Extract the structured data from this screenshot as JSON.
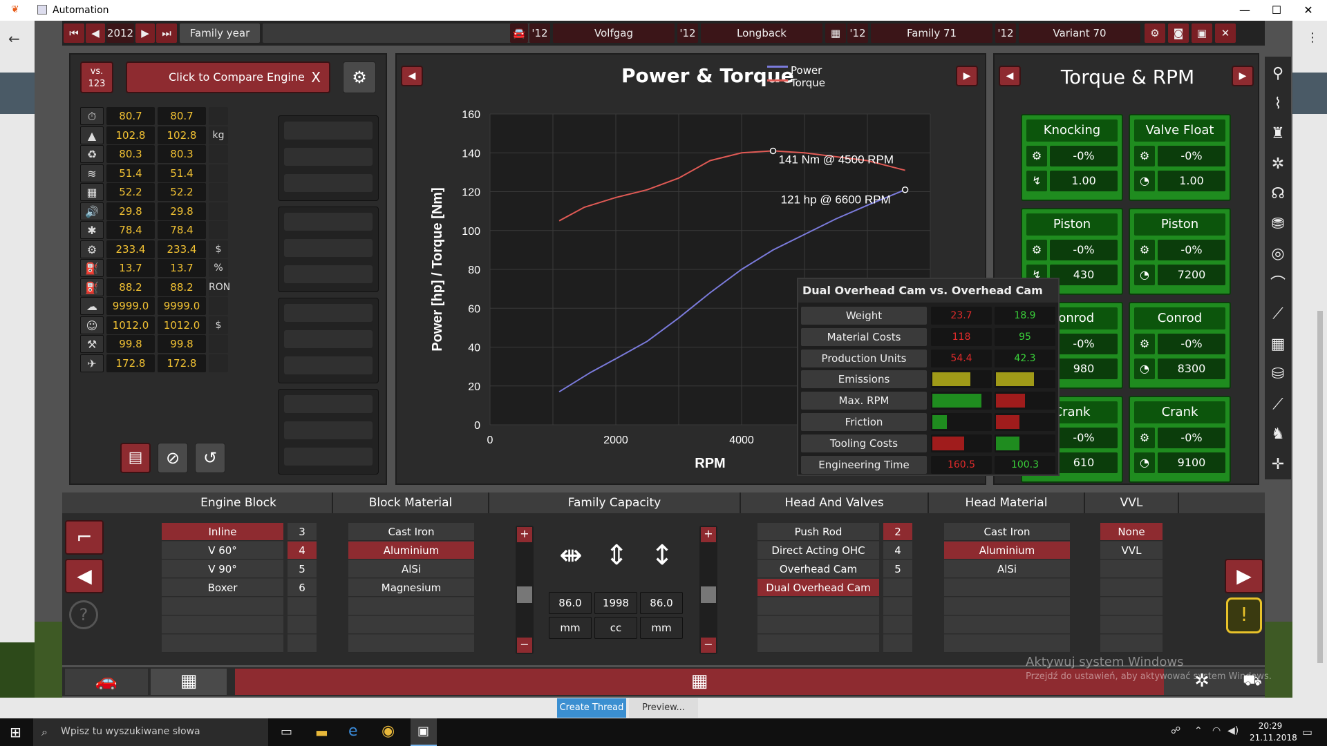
{
  "window": {
    "title": "Automation",
    "min": "—",
    "max": "☐",
    "close": "✕"
  },
  "topbar": {
    "year": "2012",
    "family_year_label": "Family year",
    "model_year_1": "'12",
    "brand": "Volfgag",
    "model_year_2": "'12",
    "model": "Longback",
    "model_year_3": "'12",
    "family": "Family 71",
    "model_year_4": "'12",
    "variant": "Variant 70"
  },
  "compare": {
    "vs_line1": "vs.",
    "vs_line2": "123",
    "label": "Click to Compare Engine",
    "close": "X"
  },
  "stats": [
    {
      "a": "80.7",
      "b": "80.7",
      "unit": "",
      "icon": "⏱"
    },
    {
      "a": "102.8",
      "b": "102.8",
      "unit": "kg",
      "icon": "▲"
    },
    {
      "a": "80.3",
      "b": "80.3",
      "unit": "",
      "icon": "♻"
    },
    {
      "a": "51.4",
      "b": "51.4",
      "unit": "",
      "icon": "≋"
    },
    {
      "a": "52.2",
      "b": "52.2",
      "unit": "",
      "icon": "▦"
    },
    {
      "a": "29.8",
      "b": "29.8",
      "unit": "",
      "icon": "🔊"
    },
    {
      "a": "78.4",
      "b": "78.4",
      "unit": "",
      "icon": "✱"
    },
    {
      "a": "233.4",
      "b": "233.4",
      "unit": "$",
      "icon": "⚙"
    },
    {
      "a": "13.7",
      "b": "13.7",
      "unit": "%",
      "icon": "⛽"
    },
    {
      "a": "88.2",
      "b": "88.2",
      "unit": "RON",
      "icon": "⛽"
    },
    {
      "a": "9999.0",
      "b": "9999.0",
      "unit": "",
      "icon": "☁"
    },
    {
      "a": "1012.0",
      "b": "1012.0",
      "unit": "$",
      "icon": "☺"
    },
    {
      "a": "99.8",
      "b": "99.8",
      "unit": "",
      "icon": "⚒"
    },
    {
      "a": "172.8",
      "b": "172.8",
      "unit": "",
      "icon": "✈"
    }
  ],
  "chart_header": {
    "title": "Power & Torque"
  },
  "chart_data": {
    "type": "line",
    "title": "Power & Torque",
    "xlabel": "RPM",
    "ylabel": "Power [hp] / Torque [Nm]",
    "xlim": [
      0,
      7000
    ],
    "ylim": [
      0,
      160
    ],
    "xticks": [
      0,
      2000,
      4000
    ],
    "yticks": [
      0,
      20,
      40,
      60,
      80,
      100,
      120,
      140,
      160
    ],
    "grid": true,
    "legend": "top",
    "series": [
      {
        "name": "Power",
        "color": "#7b7bdc",
        "x": [
          1100,
          1600,
          2000,
          2500,
          3000,
          3500,
          4000,
          4500,
          5000,
          5500,
          6000,
          6600
        ],
        "y": [
          17,
          27,
          34,
          43,
          55,
          68,
          80,
          90,
          98,
          106,
          113,
          121
        ]
      },
      {
        "name": "Torque",
        "color": "#e05a55",
        "x": [
          1100,
          1500,
          2000,
          2500,
          3000,
          3500,
          4000,
          4500,
          5000,
          5500,
          6000,
          6600
        ],
        "y": [
          105,
          112,
          117,
          121,
          127,
          136,
          140,
          141,
          140,
          138,
          136,
          131
        ]
      }
    ],
    "annotations": [
      {
        "text": "141 Nm @ 4500 RPM",
        "x": 4500,
        "y": 141
      },
      {
        "text": "121 hp @ 6600 RPM",
        "x": 6600,
        "y": 121
      }
    ]
  },
  "torque_panel": {
    "title": "Torque & RPM",
    "items": [
      {
        "name": "Knocking",
        "pct": "-0%",
        "val": "1.00"
      },
      {
        "name": "Valve Float",
        "pct": "-0%",
        "val": "1.00"
      },
      {
        "name": "Piston",
        "pct": "-0%",
        "val": "430"
      },
      {
        "name": "Piston",
        "pct": "-0%",
        "val": "7200"
      },
      {
        "name": "Conrod",
        "pct": "-0%",
        "val": "980"
      },
      {
        "name": "Conrod",
        "pct": "-0%",
        "val": "8300"
      },
      {
        "name": "Crank",
        "pct": "-0%",
        "val": "610"
      },
      {
        "name": "Crank",
        "pct": "-0%",
        "val": "9100"
      }
    ]
  },
  "tooltip": {
    "title": "Dual Overhead Cam  vs.  Overhead Cam",
    "rows": [
      {
        "label": "Weight",
        "a": "23.7",
        "b": "18.9"
      },
      {
        "label": "Material Costs",
        "a": "118",
        "b": "95"
      },
      {
        "label": "Production Units",
        "a": "54.4",
        "b": "42.3"
      },
      {
        "label": "Emissions",
        "a": "",
        "b": ""
      },
      {
        "label": "Max. RPM",
        "a": "",
        "b": ""
      },
      {
        "label": "Friction",
        "a": "",
        "b": ""
      },
      {
        "label": "Tooling Costs",
        "a": "",
        "b": ""
      },
      {
        "label": "Engineering Time",
        "a": "160.5",
        "b": "100.3"
      }
    ],
    "bars": {
      "emissions": {
        "a": 0.65,
        "b": 0.65,
        "ca": "#a09a18",
        "cb": "#a09a18"
      },
      "max_rpm": {
        "a": 0.85,
        "b": 0.5,
        "ca": "#1f8c1f",
        "cb": "#a01c1c"
      },
      "friction": {
        "a": 0.25,
        "b": 0.4,
        "ca": "#1f8c1f",
        "cb": "#a01c1c"
      },
      "tooling": {
        "a": 0.55,
        "b": 0.4,
        "ca": "#a01c1c",
        "cb": "#1f8c1f"
      }
    },
    "colors": {
      "worse": "#e02b2b",
      "better": "#3ad13a"
    }
  },
  "bottom": {
    "engine_block": {
      "title": "Engine Block",
      "options": [
        "Inline",
        "V 60°",
        "V 90°",
        "Boxer"
      ],
      "nums": [
        "3",
        "4",
        "5",
        "6"
      ]
    },
    "block_material": {
      "title": "Block Material",
      "options": [
        "Cast Iron",
        "Aluminium",
        "AlSi",
        "Magnesium"
      ]
    },
    "family_capacity": {
      "title": "Family Capacity",
      "bore": "86.0",
      "cc": "1998",
      "stroke": "86.0",
      "unit1": "mm",
      "unit2": "cc",
      "unit3": "mm",
      "plus": "+",
      "minus": "−"
    },
    "head_valves": {
      "title": "Head And Valves",
      "options": [
        "Push Rod",
        "Direct Acting OHC",
        "Overhead Cam",
        "Dual Overhead Cam"
      ],
      "nums": [
        "2",
        "4",
        "5"
      ]
    },
    "head_material": {
      "title": "Head Material",
      "options": [
        "Cast Iron",
        "Aluminium",
        "AlSi"
      ]
    },
    "vvl": {
      "title": "VVL",
      "options": [
        "None",
        "VVL"
      ]
    }
  },
  "watermark": {
    "line1": "Aktywuj system Windows",
    "line2": "Przejdź do ustawień, aby aktywować system Windows."
  },
  "forum": {
    "create": "Create Thread",
    "preview": "Preview..."
  },
  "taskbar": {
    "search": "Wpisz tu wyszukiwane słowa",
    "time": "20:29",
    "date": "21.11.2018"
  }
}
